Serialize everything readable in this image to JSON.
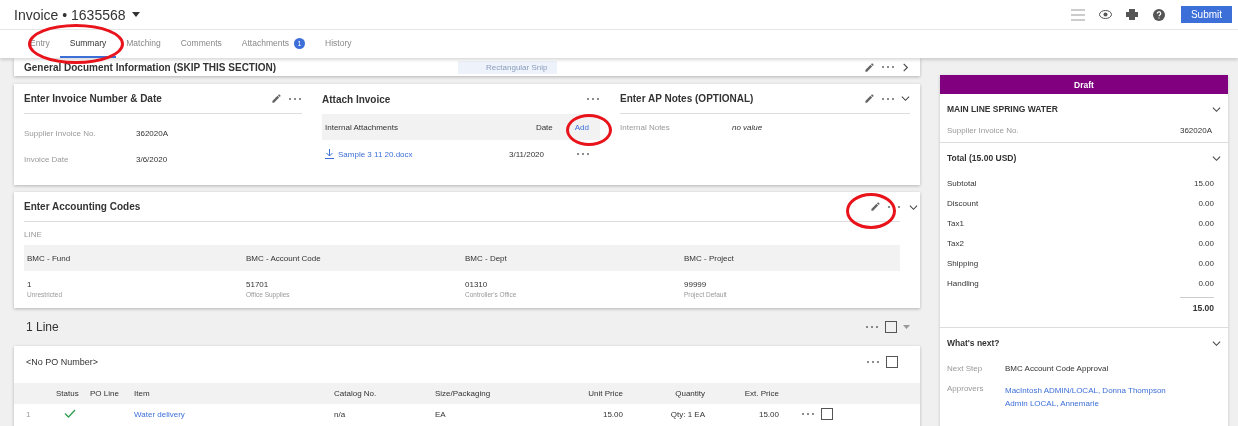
{
  "header": {
    "doc_type": "Invoice",
    "separator": "•",
    "number": "1635568",
    "submit": "Submit"
  },
  "tabs": [
    {
      "label": "Entry",
      "selected": false,
      "highlight": false
    },
    {
      "label": "Summary",
      "selected": true,
      "highlight": true
    },
    {
      "label": "Matching",
      "selected": false,
      "highlight": false
    },
    {
      "label": "Comments",
      "selected": false,
      "highlight": false
    },
    {
      "label": "Attachments",
      "selected": false,
      "highlight": false,
      "badge": "1"
    },
    {
      "label": "History",
      "selected": false,
      "highlight": false
    }
  ],
  "general_section": {
    "title": "General Document Information (SKIP THIS SECTION)",
    "snip_label": "Rectangular Snip"
  },
  "invoice_card": {
    "title": "Enter Invoice Number & Date",
    "fields": [
      {
        "label": "Supplier Invoice No.",
        "value": "362020A"
      },
      {
        "label": "Invoice Date",
        "value": "3/6/2020"
      }
    ]
  },
  "attach_card": {
    "title": "Attach Invoice",
    "columns": [
      "Internal Attachments",
      "Date"
    ],
    "add": "Add",
    "add_highlight": true,
    "files": [
      {
        "name": "Sample 3 11 20.docx",
        "date": "3/11/2020"
      }
    ]
  },
  "notes_card": {
    "title": "Enter AP Notes (OPTIONAL)",
    "label": "Internal Notes",
    "value": "no value"
  },
  "accounting_card": {
    "title": "Enter Accounting Codes",
    "edit_highlight": true,
    "group": "LINE",
    "columns": [
      {
        "name": "BMC - Fund",
        "code": "1",
        "desc": "Unrestricted"
      },
      {
        "name": "BMC - Account Code",
        "code": "51701",
        "desc": "Office Supplies"
      },
      {
        "name": "BMC - Dept",
        "code": "01310",
        "desc": "Controller's Office"
      },
      {
        "name": "BMC - Project",
        "code": "99999",
        "desc": "Project Default"
      }
    ]
  },
  "lines": {
    "title": "1 Line",
    "all_checked": false,
    "po_checked": false,
    "po_title": "<No PO Number>",
    "columns": [
      "Status",
      "PO Line",
      "Item",
      "Catalog No.",
      "Size/Packaging",
      "Unit Price",
      "Quantity",
      "Ext. Price"
    ],
    "rows": [
      {
        "num": "1",
        "status_ok": true,
        "checked": false,
        "item": "Water delivery",
        "catalog": "n/a",
        "size": "EA",
        "unit_price": "15.00",
        "quantity": "Qty: 1 EA",
        "ext_price": "15.00"
      }
    ]
  },
  "side": {
    "status": "Draft",
    "supplier": "MAIN LINE SPRING WATER",
    "supplier_field": {
      "label": "Supplier Invoice No.",
      "value": "362020A"
    },
    "total_title": "Total (15.00 USD)",
    "totals": [
      {
        "label": "Subtotal",
        "value": "15.00"
      },
      {
        "label": "Discount",
        "value": "0.00"
      },
      {
        "label": "Tax1",
        "value": "0.00"
      },
      {
        "label": "Tax2",
        "value": "0.00"
      },
      {
        "label": "Shipping",
        "value": "0.00"
      },
      {
        "label": "Handling",
        "value": "0.00"
      }
    ],
    "grand_total": "15.00",
    "next_title": "What's next?",
    "next_step": {
      "label": "Next Step",
      "value": "BMC Account Code Approval"
    },
    "approvers": {
      "label": "Approvers",
      "value": "MacIntosh ADMIN/LOCAL, Donna Thompson Admin LOCAL, Annemarie"
    }
  }
}
